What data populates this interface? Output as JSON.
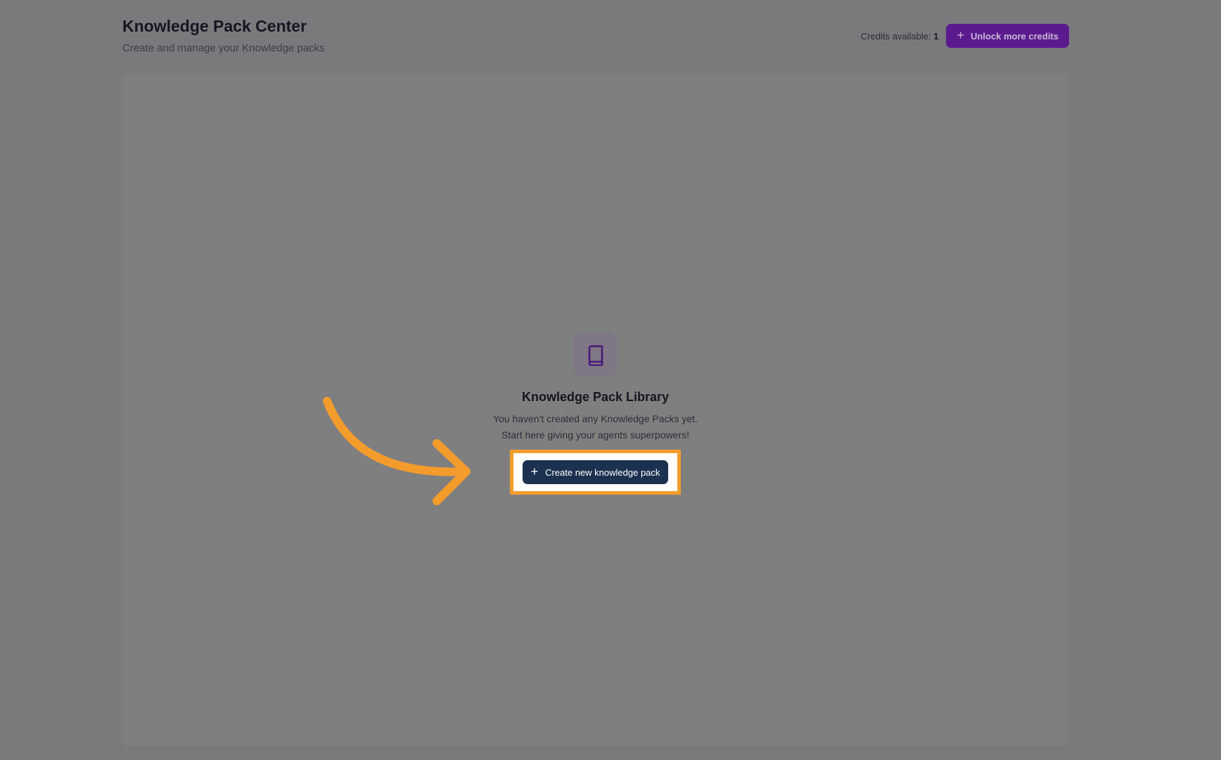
{
  "header": {
    "title": "Knowledge Pack Center",
    "subtitle": "Create and manage your Knowledge packs",
    "credits_label": "Credits available:",
    "credits_value": "1",
    "unlock_label": "Unlock more credits"
  },
  "empty_state": {
    "icon": "book-icon",
    "title": "Knowledge Pack Library",
    "line1": "You haven't created any Knowledge Packs yet.",
    "line2": "Start here giving your agents superpowers!",
    "create_label": "Create new knowledge pack"
  },
  "colors": {
    "accent_purple": "#5b1b8e",
    "create_button": "#1c3150",
    "highlight_orange": "#f39c2c"
  },
  "annotation": {
    "arrow_icon": "curved-arrow-icon"
  }
}
